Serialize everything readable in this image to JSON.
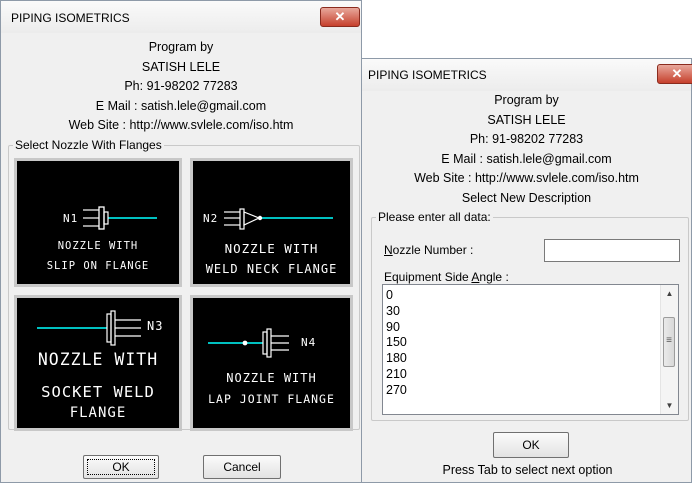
{
  "left_dialog": {
    "title": "PIPING ISOMETRICS",
    "close_glyph": "✕",
    "info_lines": [
      "Program by",
      "SATISH LELE",
      "Ph: 91-98202 77283",
      "E Mail : satish.lele@gmail.com",
      "Web Site : http://www.svlele.com/iso.htm"
    ],
    "group_label": "Select Nozzle With Flanges",
    "tiles": [
      {
        "tag": "N1",
        "line1": "NOZZLE WITH",
        "line2": "SLIP ON FLANGE"
      },
      {
        "tag": "N2",
        "line1": "NOZZLE WITH",
        "line2": "WELD NECK FLANGE"
      },
      {
        "tag": "N3",
        "line1": "NOZZLE WITH",
        "line2": "SOCKET WELD",
        "line3": "FLANGE"
      },
      {
        "tag": "N4",
        "line1": "NOZZLE WITH",
        "line2": "LAP JOINT FLANGE"
      }
    ],
    "ok_label": "OK",
    "cancel_label": "Cancel"
  },
  "right_dialog": {
    "title": "PIPING ISOMETRICS",
    "close_glyph": "✕",
    "info_lines": [
      "Program by",
      "SATISH LELE",
      "Ph: 91-98202 77283",
      "E Mail : satish.lele@gmail.com",
      "Web Site : http://www.svlele.com/iso.htm",
      "Select New Description"
    ],
    "group_label": "Please enter all data:",
    "nozzle_label_key": "N",
    "nozzle_label_rest": "ozzle Number :",
    "nozzle_value": "",
    "angle_label_pre": "Equipment Side ",
    "angle_label_key": "A",
    "angle_label_rest": "ngle :",
    "angles": [
      "0",
      "30",
      "90",
      "150",
      "180",
      "210",
      "270"
    ],
    "ok_label": "OK",
    "hint": "Press Tab to select next option"
  }
}
